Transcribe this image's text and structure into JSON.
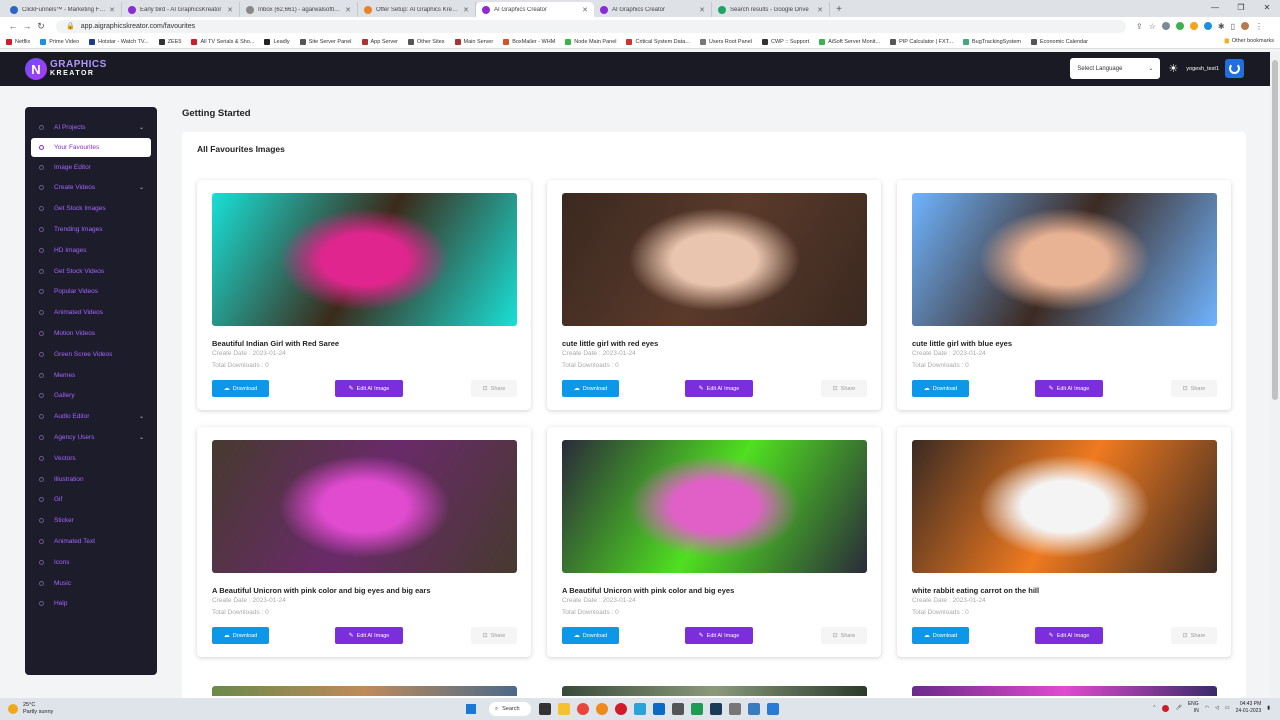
{
  "browser": {
    "tabs": [
      {
        "title": "ClickFunnels™ - Marketing Funnels",
        "color": "#2f63c7"
      },
      {
        "title": "Early bird - AI GraphicsKreator",
        "color": "#8a2bd6"
      },
      {
        "title": "Inbox (62,661) - agarwalsoftlabs",
        "color": "#888888"
      },
      {
        "title": "Offer Setup: AI Graphics Kreator",
        "color": "#e6832b"
      },
      {
        "title": "AI Graphics Creator",
        "color": "#8a2bd6",
        "active": true
      },
      {
        "title": "AI Graphics Creator",
        "color": "#8a2bd6"
      },
      {
        "title": "Search results - Google Drive",
        "color": "#1fa463"
      }
    ],
    "new_tab": "+",
    "url": "app.aigraphicskreator.com/favourites",
    "bookmarks": [
      "Netflix",
      "Prime Video",
      "Hotstar - Watch TV...",
      "ZEE5",
      "All TV Serials & Sho...",
      "Leadly",
      "Site Server Panel",
      "App Server",
      "Other Sites",
      "Main Server",
      "BoxMailer - WHM",
      "Node Main Panel",
      "Critical System Data...",
      "Users Root Panel",
      "CWP :: Support",
      "AiSoft Server Monit...",
      "PIP Calculator | FXT...",
      "BugTrackingSystem",
      "Economic Calendar"
    ],
    "other_bookmarks": "Other bookmarks"
  },
  "header": {
    "logo_letter": "N",
    "logo_line1": "GRAPHICS",
    "logo_line2": "KREATOR",
    "language": "Select Language",
    "username": "yogesh_test1"
  },
  "sidebar": {
    "items": [
      {
        "label": "AI Projects",
        "chevron": true
      },
      {
        "label": "Your Favourites",
        "active": true
      },
      {
        "label": "Image Editor"
      },
      {
        "label": "Create Videos",
        "chevron": true
      },
      {
        "label": "Get Stock Images"
      },
      {
        "label": "Trending Images"
      },
      {
        "label": "HD Images"
      },
      {
        "label": "Get Stock Videos"
      },
      {
        "label": "Popular Videos"
      },
      {
        "label": "Animated Videos"
      },
      {
        "label": "Motion Videos"
      },
      {
        "label": "Green Scree Videos"
      },
      {
        "label": "Memes"
      },
      {
        "label": "Gallery"
      },
      {
        "label": "Audio Editor",
        "chevron": true
      },
      {
        "label": "Agency Users",
        "chevron": true
      },
      {
        "label": "Vectors"
      },
      {
        "label": "Illustration"
      },
      {
        "label": "Gif"
      },
      {
        "label": "Sticker"
      },
      {
        "label": "Animated Text"
      },
      {
        "label": "Icons"
      },
      {
        "label": "Music"
      },
      {
        "label": "Help"
      }
    ]
  },
  "main": {
    "title": "Getting Started",
    "panel_title": "All Favourites Images",
    "download_label": "Download",
    "edit_label": "Edit AI Image",
    "share_label": "Share",
    "cards": [
      {
        "title": "Beautiful Indian Girl with Red Saree",
        "date": "Create Date : 2023-01-24",
        "downloads": "Total Downloads : 0",
        "colors": [
          "#19e0d6",
          "#e0268e",
          "#3b2a1a"
        ]
      },
      {
        "title": "cute little girl with red eyes",
        "date": "Create Date : 2023-01-24",
        "downloads": "Total Downloads : 0",
        "colors": [
          "#3a2820",
          "#e9c4ae",
          "#5a3a2a"
        ]
      },
      {
        "title": "cute little girl with blue eyes",
        "date": "Create Date : 2023-01-24",
        "downloads": "Total Downloads : 0",
        "colors": [
          "#6fb4ff",
          "#e8b294",
          "#3c2a22"
        ]
      },
      {
        "title": "A Beautiful Unicron with pink color and big eyes and big ears",
        "date": "Create Date : 2023-01-24",
        "downloads": "Total Downloads : 0",
        "colors": [
          "#463a2e",
          "#e04bd0",
          "#6a2a6a"
        ]
      },
      {
        "title": "A Beautiful Unicron with pink color and big eyes",
        "date": "Create Date : 2023-01-24",
        "downloads": "Total Downloads : 0",
        "colors": [
          "#2a2a3a",
          "#e060c8",
          "#50e020"
        ]
      },
      {
        "title": "white rabbit eating carrot on the hill",
        "date": "Create Date : 2023-01-24",
        "downloads": "Total Downloads : 0",
        "colors": [
          "#3a2a22",
          "#f4f4f4",
          "#f07a20"
        ]
      }
    ]
  },
  "taskbar": {
    "temp": "25°C",
    "weather": "Partly sunny",
    "search": "Search",
    "lang1": "ENG",
    "lang2": "IN",
    "time": "04:43 PM",
    "date": "24-01-2023"
  }
}
